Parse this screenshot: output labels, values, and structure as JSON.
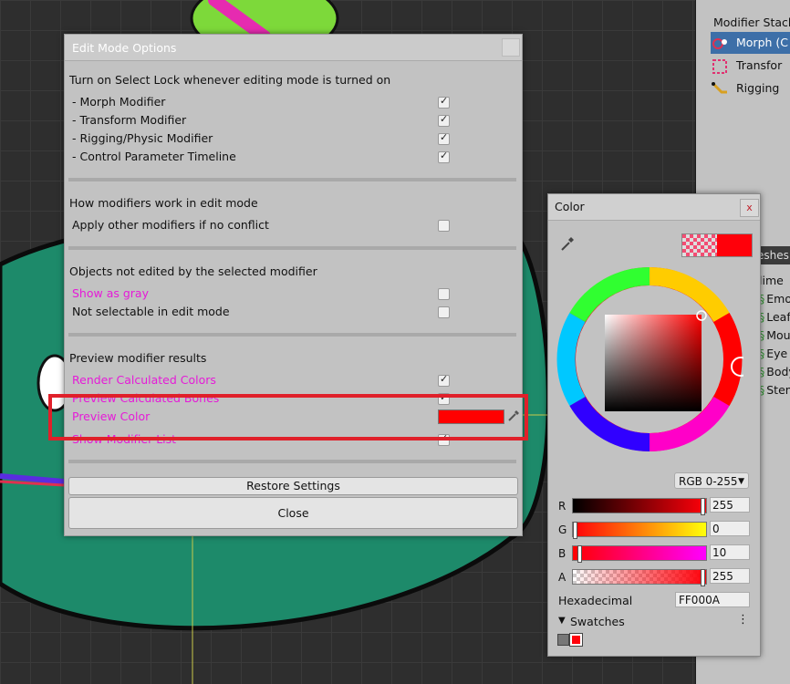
{
  "edit_dialog": {
    "title": "Edit Mode Options",
    "section1": {
      "title": "Turn on Select Lock whenever editing mode is turned on",
      "items": [
        {
          "label": "- Morph Modifier",
          "checked": true
        },
        {
          "label": "- Transform Modifier",
          "checked": true
        },
        {
          "label": "- Rigging/Physic Modifier",
          "checked": true
        },
        {
          "label": "- Control Parameter Timeline",
          "checked": true
        }
      ]
    },
    "section2": {
      "title": "How modifiers work in edit mode",
      "items": [
        {
          "label": "Apply other modifiers if no conflict",
          "checked": false
        }
      ]
    },
    "section3": {
      "title": "Objects not edited by the selected modifier",
      "items": [
        {
          "label": "Show as gray",
          "checked": false
        },
        {
          "label": "Not selectable in edit mode",
          "checked": false
        }
      ]
    },
    "section4": {
      "title": "Preview modifier results",
      "items": [
        {
          "label": "Render Calculated Colors",
          "checked": true
        },
        {
          "label": "Preview Calculated Bones",
          "checked": true
        },
        {
          "label": "Preview Color",
          "color": "#ff0000"
        },
        {
          "label": "Show Modifier List",
          "checked": true
        }
      ]
    },
    "restore_label": "Restore Settings",
    "close_label": "Close"
  },
  "color_dialog": {
    "title": "Color",
    "close_label": "x",
    "mode": "RGB 0-255",
    "channels": [
      {
        "name": "R",
        "value": "255"
      },
      {
        "name": "G",
        "value": "0"
      },
      {
        "name": "B",
        "value": "10"
      },
      {
        "name": "A",
        "value": "255"
      }
    ],
    "hex_label": "Hexadecimal",
    "hex_value": "FF000A",
    "swatches_label": "Swatches",
    "current_color": "#ff000a"
  },
  "right_panel": {
    "header": "Modifier Stack",
    "modifiers": [
      {
        "label": "Morph (C",
        "selected": true
      },
      {
        "label": "Transfor",
        "selected": false
      },
      {
        "label": "Rigging",
        "selected": false
      }
    ],
    "meshes_tab": "eshes",
    "mesh_items": [
      "lime",
      "Emo",
      "Leaf",
      "Mou",
      "Eye",
      "Body",
      "Stem"
    ]
  }
}
